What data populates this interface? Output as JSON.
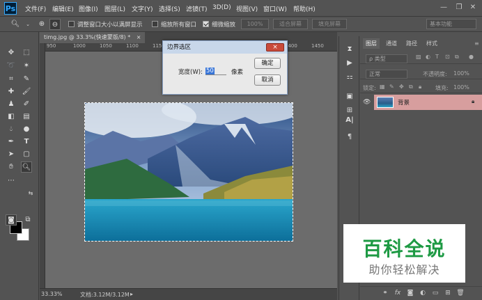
{
  "app": {
    "logo": "Ps",
    "menus": [
      "文件(F)",
      "编辑(E)",
      "图像(I)",
      "图层(L)",
      "文字(Y)",
      "选择(S)",
      "滤镜(T)",
      "3D(D)",
      "视图(V)",
      "窗口(W)",
      "帮助(H)"
    ]
  },
  "options": {
    "resize_window_label": "调整窗口大小以满屏显示",
    "zoom_all_label": "缩放所有窗口",
    "scrubby_zoom_label": "细微缩放",
    "zoom_value": "100%",
    "fit_screen": "适合屏幕",
    "fill_screen": "填充屏幕",
    "workspace": "基本功能"
  },
  "document": {
    "tab_title": "timg.jpg @ 33.3%(快速蒙版/8) *",
    "tab_close": "×",
    "ruler_ticks": [
      "950",
      "1000",
      "1050",
      "1100",
      "1150",
      "1200",
      "1250",
      "1300",
      "1350",
      "1400",
      "1450"
    ],
    "zoom": "33.33%",
    "doc_info": "文档:3.12M/3.12M"
  },
  "dialog": {
    "title": "边界选区",
    "width_label": "宽度(W):",
    "width_value": "50",
    "unit": "像素",
    "ok": "确定",
    "cancel": "取消",
    "close": "×"
  },
  "layers_panel": {
    "tabs": [
      "图层",
      "通道",
      "路径",
      "样式"
    ],
    "kind_filter": "ρ 类型",
    "blend_mode": "正常",
    "opacity_label": "不透明度:",
    "opacity_value": "100%",
    "lock_label": "锁定:",
    "fill_label": "填充:",
    "fill_value": "100%",
    "layer_name": "背景"
  },
  "watermark": {
    "title": "百科全说",
    "subtitle": "助你轻松解决"
  },
  "colors": {
    "ui_bg": "#535353",
    "canvas_bg": "#6c6c6c",
    "layer_selected": "#d79e9e",
    "watermark_green": "#1e9a44",
    "ps_blue": "#31a8ff"
  }
}
